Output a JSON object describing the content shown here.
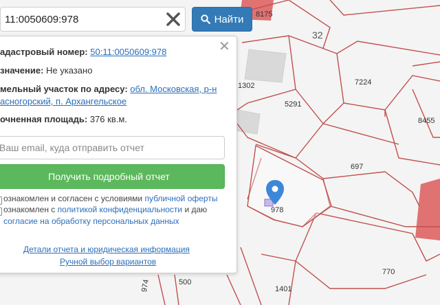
{
  "search": {
    "value": "11:0050609:978",
    "button_label": "Найти",
    "button_icon": "search-icon",
    "clear_icon": "close-x-icon"
  },
  "panel": {
    "cadastral_label": "адастровый номер:",
    "cadastral_value": "50:11:0050609:978",
    "purpose_label": "значение:",
    "purpose_value": "Не указано",
    "address_label": "мельный участок по адресу:",
    "address_line1": "обл. Московская, р-н",
    "address_line2": "асногорский, п. Архангельское",
    "area_label": "очненная площадь:",
    "area_value": "376 кв.м.",
    "email_placeholder": "Ваш email, куда отправить отчет",
    "report_button": "Получить подробный отчет",
    "consent1_text": "ознакомлен и согласен с условиями",
    "consent1_link": "публичной оферты",
    "consent2_text": "ознакомлен с",
    "consent2_link": "политикой конфиденциальности",
    "consent2_tail": "и даю",
    "consent3_link": "согласие на обработку персональных данных",
    "details_link": "Детали отчета и юридическая информация",
    "manual_link": "Ручной выбор вариантов"
  },
  "map": {
    "selected_plot": "978",
    "plot_labels": [
      "8175",
      "32",
      "1302",
      "7224",
      "5291",
      "8455",
      "697",
      "770",
      "974",
      "500",
      "1401"
    ],
    "colors": {
      "background": "#f4f4f4",
      "boundary": "#c0504d",
      "filled_plot": "#e07272",
      "pin": "#3d87d9"
    }
  }
}
